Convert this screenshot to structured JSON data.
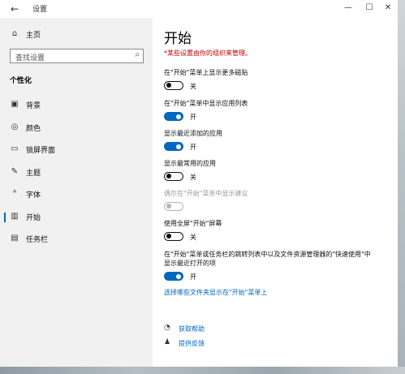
{
  "window": {
    "title": "设置",
    "back_glyph": "←",
    "minimize_glyph": "—",
    "maximize_glyph": "☐",
    "close_glyph": "✕"
  },
  "sidebar": {
    "home": {
      "label": "主页",
      "icon": "home-icon",
      "glyph": "⌂"
    },
    "search": {
      "placeholder": "查找设置",
      "icon": "search-icon",
      "glyph": "⌕"
    },
    "section": "个性化",
    "items": [
      {
        "label": "背景",
        "icon": "background-image-icon",
        "glyph": "▣",
        "active": false
      },
      {
        "label": "颜色",
        "icon": "palette-icon",
        "glyph": "◎",
        "active": false
      },
      {
        "label": "锁屏界面",
        "icon": "lock-screen-icon",
        "glyph": "▭",
        "active": false
      },
      {
        "label": "主题",
        "icon": "theme-brush-icon",
        "glyph": "✎",
        "active": false
      },
      {
        "label": "字体",
        "icon": "font-icon",
        "glyph": "ᴬ",
        "active": false
      },
      {
        "label": "开始",
        "icon": "start-menu-icon",
        "glyph": "▥",
        "active": true
      },
      {
        "label": "任务栏",
        "icon": "taskbar-icon",
        "glyph": "▤",
        "active": false
      }
    ],
    "accent_color": "#0067c0"
  },
  "main": {
    "title": "开始",
    "warning": "*某些设置由你的组织来管理。",
    "settings": [
      {
        "label": "在\"开始\"菜单上显示更多磁贴",
        "state": "off",
        "state_label": "关"
      },
      {
        "label": "在\"开始\"菜单中显示应用列表",
        "state": "on",
        "state_label": "开"
      },
      {
        "label": "显示最近添加的应用",
        "state": "on",
        "state_label": "开"
      },
      {
        "label": "显示最常用的应用",
        "state": "off",
        "state_label": "关"
      },
      {
        "label": "偶尔在\"开始\"菜单中显示建议",
        "state": "disabled",
        "state_label": ""
      },
      {
        "label": "使用全屏\"开始\"屏幕",
        "state": "off",
        "state_label": "关"
      },
      {
        "label": "在\"开始\"菜单或任务栏的跳转列表中以及文件资源管理器的\"快速使用\"中",
        "label_line2": "显示最近打开的项",
        "state": "on",
        "state_label": "开"
      }
    ],
    "folders_link": "选择哪些文件夹显示在\"开始\"菜单上",
    "help": [
      {
        "label": "获取帮助",
        "icon": "help-chat-icon",
        "glyph": "◔"
      },
      {
        "label": "提供反馈",
        "icon": "feedback-person-icon",
        "glyph": "♟"
      }
    ],
    "warning_color": "#c00000",
    "toggle_on_color": "#0067c0"
  }
}
